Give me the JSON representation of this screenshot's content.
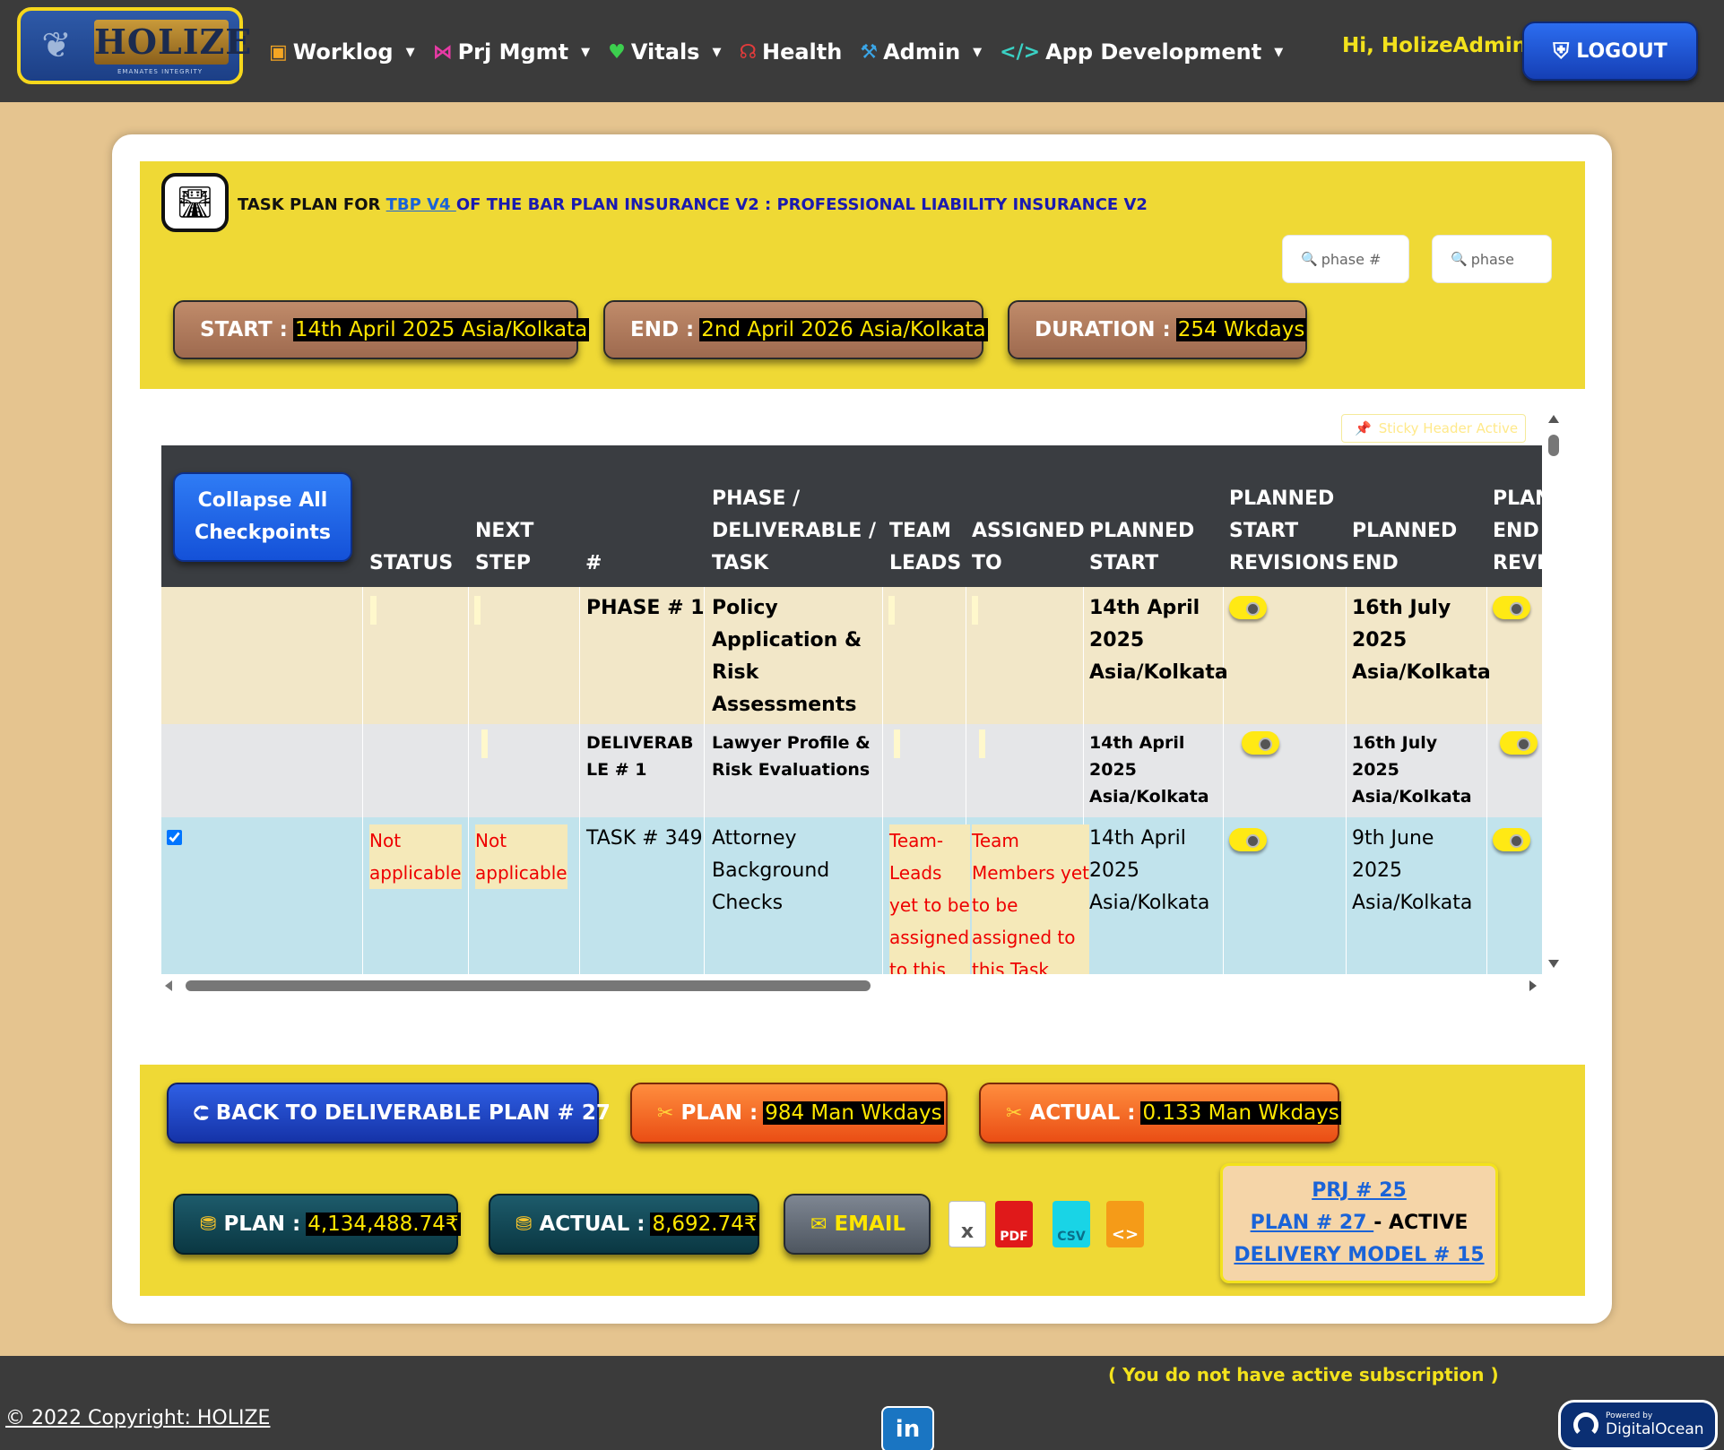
{
  "nav": {
    "logo_text": "HOLIZE",
    "logo_tagline": "EMANATES INTEGRITY",
    "menu": [
      {
        "label": "Worklog",
        "icon": "briefcase-icon",
        "caret": true
      },
      {
        "label": "Prj Mgmt",
        "icon": "network-icon",
        "caret": true
      },
      {
        "label": "Vitals",
        "icon": "heart-pulse-icon",
        "caret": true
      },
      {
        "label": "Health",
        "icon": "stethoscope-icon",
        "caret": false
      },
      {
        "label": "Admin",
        "icon": "hammer-icon",
        "caret": true
      },
      {
        "label": "App Development",
        "icon": "code-icon",
        "caret": true
      }
    ],
    "greeting": "Hi, HolizeAdmin",
    "logout": "LOGOUT"
  },
  "header": {
    "title_prefix": "TASK PLAN FOR ",
    "title_link": "TBP V4 ",
    "title_suffix": "OF THE BAR PLAN INSURANCE V2 : PROFESSIONAL LIABILITY INSURANCE V2",
    "search_phase_num": "phase #",
    "search_phase": "phase",
    "start_label": "START :",
    "start_value": "14th April 2025 Asia/Kolkata",
    "end_label": "END :",
    "end_value": "2nd April 2026 Asia/Kolkata",
    "duration_label": "DURATION :",
    "duration_value": "254 Wkdays"
  },
  "table": {
    "sticky_label": "Sticky Header Active",
    "collapse_button": "Collapse All\nCheckpoints",
    "columns": [
      "STATUS",
      "NEXT\nSTEP",
      "#",
      "PHASE /\nDELIVERABLE /\nTASK",
      "TEAM\nLEADS",
      "ASSIGNED\nTO",
      "PLANNED\nSTART",
      "PLANNED\nSTART\nREVISIONS",
      "PLANNED\nEND",
      "PLAN\nEND\nREVIS"
    ],
    "phase_row": {
      "num": "PHASE # 1",
      "name": "Policy\nApplication &\nRisk\nAssessments",
      "planned_start": "14th April\n2025\nAsia/Kolkata",
      "planned_end": "16th July\n2025\nAsia/Kolkata"
    },
    "deliverable_row": {
      "num": "DELIVERAB\nLE # 1",
      "name": "Lawyer Profile &\nRisk Evaluations",
      "planned_start": "14th April\n2025\nAsia/Kolkata",
      "planned_end": "16th July\n2025\nAsia/Kolkata"
    },
    "task_row": {
      "checked": true,
      "status": "Not\napplicable",
      "next_step": "Not\napplicable",
      "num": "TASK # 349",
      "name": "Attorney\nBackground\nChecks",
      "team_leads": "Team-\nLeads\nyet to be\nassigned\nto this",
      "assigned_to": "Team\nMembers yet\nto be\nassigned to\nthis Task",
      "planned_start": "14th April\n2025\nAsia/Kolkata",
      "planned_end": "9th June\n2025\nAsia/Kolkata"
    }
  },
  "footer_band": {
    "back_button": "BACK TO DELIVERABLE PLAN # 27",
    "plan_label": "PLAN :",
    "plan_value": "984 Man Wkdays",
    "actual_label": "ACTUAL :",
    "actual_value": "0.133 Man Wkdays",
    "plan_cost_label": "PLAN :",
    "plan_cost_value": "4,134,488.74₹",
    "actual_cost_label": "ACTUAL :",
    "actual_cost_value": "8,692.74₹",
    "email_button": "EMAIL",
    "export_icons": [
      "excel-icon",
      "pdf-icon",
      "csv-icon",
      "code-file-icon"
    ],
    "prj_link": "PRJ # 25",
    "plan_link": "PLAN # 27 ",
    "plan_status": "- ACTIVE",
    "delivery_link": "DELIVERY MODEL # 15"
  },
  "footer": {
    "subscription_msg": "( You do not have active subscription )",
    "copyright": "© 2022 Copyright: HOLIZE",
    "linkedin": "in",
    "powered_by": "Powered by",
    "do_brand": "DigitalOcean"
  }
}
